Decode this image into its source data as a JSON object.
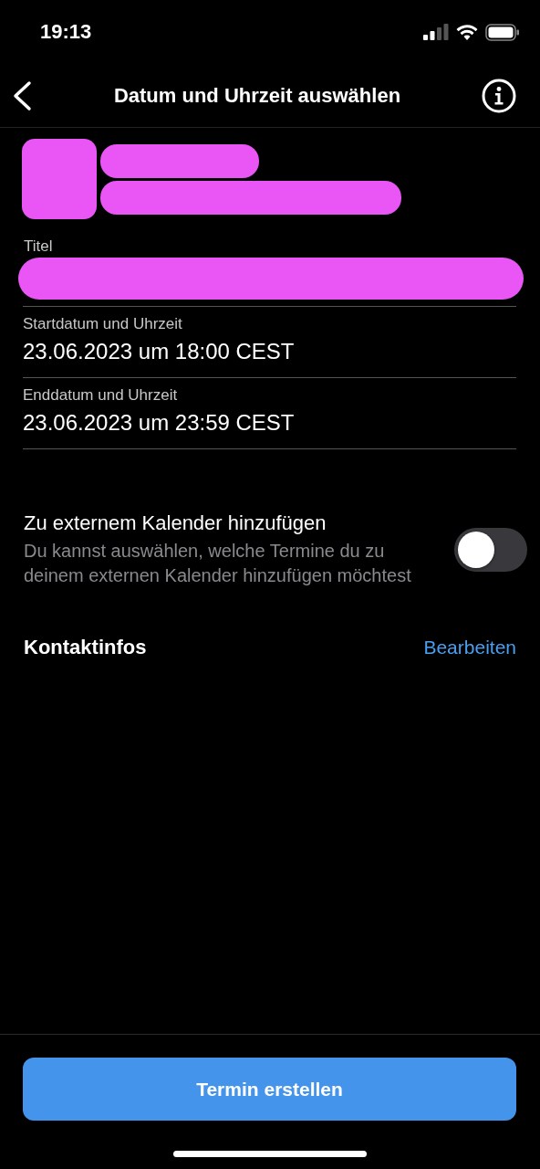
{
  "status_bar": {
    "time": "19:13"
  },
  "nav_bar": {
    "title": "Datum und Uhrzeit auswählen"
  },
  "form": {
    "title_label": "Titel",
    "fields": [
      {
        "label": "Startdatum und Uhrzeit",
        "value": "23.06.2023 um 18:00  CEST"
      },
      {
        "label": "Enddatum und Uhrzeit",
        "value": "23.06.2023 um 23:59  CEST"
      }
    ]
  },
  "external_calendar": {
    "title": "Zu externem Kalender hinzufügen",
    "description": "Du kannst auswählen, welche Termine du zu deinem externen Kalender hinzufügen möchtest",
    "on": false
  },
  "contact": {
    "title": "Kontaktinfos",
    "action": "Bearbeiten"
  },
  "primary_button": "Termin erstellen"
}
